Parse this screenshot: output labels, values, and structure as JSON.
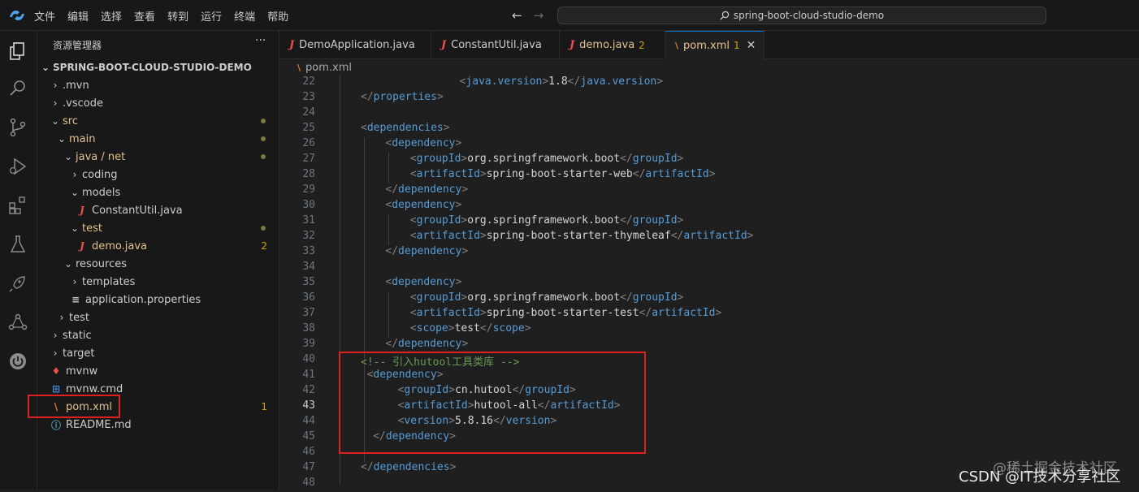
{
  "menu": [
    "文件",
    "编辑",
    "选择",
    "查看",
    "转到",
    "运行",
    "终端",
    "帮助"
  ],
  "search": {
    "text": "spring-boot-cloud-studio-demo"
  },
  "sidebar": {
    "title": "资源管理器",
    "more": "···",
    "root": "SPRING-BOOT-CLOUD-STUDIO-DEMO",
    "items": [
      {
        "label": ".mvn"
      },
      {
        "label": ".vscode"
      },
      {
        "label": "src"
      },
      {
        "label": "main"
      },
      {
        "label": "java / net"
      },
      {
        "label": "coding"
      },
      {
        "label": "models"
      },
      {
        "label": "ConstantUtil.java"
      },
      {
        "label": "test"
      },
      {
        "label": "demo.java",
        "badge": "2"
      },
      {
        "label": "resources"
      },
      {
        "label": "templates"
      },
      {
        "label": "application.properties"
      },
      {
        "label": "test"
      },
      {
        "label": "static"
      },
      {
        "label": "target"
      },
      {
        "label": "mvnw"
      },
      {
        "label": "mvnw.cmd"
      },
      {
        "label": "pom.xml",
        "badge": "1"
      },
      {
        "label": "README.md"
      }
    ]
  },
  "tabs": [
    {
      "label": "DemoApplication.java"
    },
    {
      "label": "ConstantUtil.java"
    },
    {
      "label": "demo.java",
      "badge": "2"
    },
    {
      "label": "pom.xml",
      "badge": "1"
    }
  ],
  "breadcrumb": "pom.xml",
  "editor": {
    "lines": [
      {
        "n": "22",
        "tokens": [
          [
            "tg",
            "<"
          ],
          [
            "tn",
            "java.version"
          ],
          [
            "tg",
            ">"
          ],
          [
            "tx",
            "1.8"
          ],
          [
            "tg",
            "</"
          ],
          [
            "tn",
            "java.version"
          ],
          [
            "tg",
            ">"
          ]
        ]
      },
      {
        "n": "23",
        "tokens": [
          [
            "tg",
            "</"
          ],
          [
            "tn",
            "properties"
          ],
          [
            "tg",
            ">"
          ]
        ]
      },
      {
        "n": "24",
        "tokens": []
      },
      {
        "n": "25",
        "tokens": [
          [
            "tg",
            "<"
          ],
          [
            "tn",
            "dependencies"
          ],
          [
            "tg",
            ">"
          ]
        ]
      },
      {
        "n": "26",
        "tokens": [
          [
            "tg",
            "<"
          ],
          [
            "tn",
            "dependency"
          ],
          [
            "tg",
            ">"
          ]
        ]
      },
      {
        "n": "27",
        "tokens": [
          [
            "tg",
            "<"
          ],
          [
            "tn",
            "groupId"
          ],
          [
            "tg",
            ">"
          ],
          [
            "tx",
            "org.springframework.boot"
          ],
          [
            "tg",
            "</"
          ],
          [
            "tn",
            "groupId"
          ],
          [
            "tg",
            ">"
          ]
        ]
      },
      {
        "n": "28",
        "tokens": [
          [
            "tg",
            "<"
          ],
          [
            "tn",
            "artifactId"
          ],
          [
            "tg",
            ">"
          ],
          [
            "tx",
            "spring-boot-starter-web"
          ],
          [
            "tg",
            "</"
          ],
          [
            "tn",
            "artifactId"
          ],
          [
            "tg",
            ">"
          ]
        ]
      },
      {
        "n": "29",
        "tokens": [
          [
            "tg",
            "</"
          ],
          [
            "tn",
            "dependency"
          ],
          [
            "tg",
            ">"
          ]
        ]
      },
      {
        "n": "30",
        "tokens": [
          [
            "tg",
            "<"
          ],
          [
            "tn",
            "dependency"
          ],
          [
            "tg",
            ">"
          ]
        ]
      },
      {
        "n": "31",
        "tokens": [
          [
            "tg",
            "<"
          ],
          [
            "tn",
            "groupId"
          ],
          [
            "tg",
            ">"
          ],
          [
            "tx",
            "org.springframework.boot"
          ],
          [
            "tg",
            "</"
          ],
          [
            "tn",
            "groupId"
          ],
          [
            "tg",
            ">"
          ]
        ]
      },
      {
        "n": "32",
        "tokens": [
          [
            "tg",
            "<"
          ],
          [
            "tn",
            "artifactId"
          ],
          [
            "tg",
            ">"
          ],
          [
            "tx",
            "spring-boot-starter-thymeleaf"
          ],
          [
            "tg",
            "</"
          ],
          [
            "tn",
            "artifactId"
          ],
          [
            "tg",
            ">"
          ]
        ]
      },
      {
        "n": "33",
        "tokens": [
          [
            "tg",
            "</"
          ],
          [
            "tn",
            "dependency"
          ],
          [
            "tg",
            ">"
          ]
        ]
      },
      {
        "n": "34",
        "tokens": []
      },
      {
        "n": "35",
        "tokens": [
          [
            "tg",
            "<"
          ],
          [
            "tn",
            "dependency"
          ],
          [
            "tg",
            ">"
          ]
        ]
      },
      {
        "n": "36",
        "tokens": [
          [
            "tg",
            "<"
          ],
          [
            "tn",
            "groupId"
          ],
          [
            "tg",
            ">"
          ],
          [
            "tx",
            "org.springframework.boot"
          ],
          [
            "tg",
            "</"
          ],
          [
            "tn",
            "groupId"
          ],
          [
            "tg",
            ">"
          ]
        ]
      },
      {
        "n": "37",
        "tokens": [
          [
            "tg",
            "<"
          ],
          [
            "tn",
            "artifactId"
          ],
          [
            "tg",
            ">"
          ],
          [
            "tx",
            "spring-boot-starter-test"
          ],
          [
            "tg",
            "</"
          ],
          [
            "tn",
            "artifactId"
          ],
          [
            "tg",
            ">"
          ]
        ]
      },
      {
        "n": "38",
        "tokens": [
          [
            "tg",
            "<"
          ],
          [
            "tn",
            "scope"
          ],
          [
            "tg",
            ">"
          ],
          [
            "tx",
            "test"
          ],
          [
            "tg",
            "</"
          ],
          [
            "tn",
            "scope"
          ],
          [
            "tg",
            ">"
          ]
        ]
      },
      {
        "n": "39",
        "tokens": [
          [
            "tg",
            "</"
          ],
          [
            "tn",
            "dependency"
          ],
          [
            "tg",
            ">"
          ]
        ]
      },
      {
        "n": "40",
        "tokens": [
          [
            "cm",
            "<!-- 引入hutool工具类库 -->"
          ]
        ]
      },
      {
        "n": "41",
        "tokens": [
          [
            "tg",
            "<"
          ],
          [
            "tn",
            "dependency"
          ],
          [
            "tg",
            ">"
          ]
        ]
      },
      {
        "n": "42",
        "tokens": [
          [
            "tg",
            "<"
          ],
          [
            "tn",
            "groupId"
          ],
          [
            "tg",
            ">"
          ],
          [
            "tx",
            "cn.hutool"
          ],
          [
            "tg",
            "</"
          ],
          [
            "tn",
            "groupId"
          ],
          [
            "tg",
            ">"
          ]
        ]
      },
      {
        "n": "43",
        "tokens": [
          [
            "tg",
            "<"
          ],
          [
            "tn",
            "artifactId"
          ],
          [
            "tg",
            ">"
          ],
          [
            "tx",
            "hutool-all"
          ],
          [
            "tg",
            "</"
          ],
          [
            "tn",
            "artifactId"
          ],
          [
            "tg",
            ">"
          ]
        ]
      },
      {
        "n": "44",
        "tokens": [
          [
            "tg",
            "<"
          ],
          [
            "tn",
            "version"
          ],
          [
            "tg",
            ">"
          ],
          [
            "tx",
            "5.8.16"
          ],
          [
            "tg",
            "</"
          ],
          [
            "tn",
            "version"
          ],
          [
            "tg",
            ">"
          ]
        ]
      },
      {
        "n": "45",
        "tokens": [
          [
            "tg",
            "</"
          ],
          [
            "tn",
            "dependency"
          ],
          [
            "tg",
            ">"
          ]
        ]
      },
      {
        "n": "46",
        "tokens": []
      },
      {
        "n": "47",
        "tokens": [
          [
            "tg",
            "</"
          ],
          [
            "tn",
            "dependencies"
          ],
          [
            "tg",
            ">"
          ]
        ]
      },
      {
        "n": "48",
        "tokens": []
      }
    ]
  },
  "watermark": {
    "csdn": "CSDN @IT技术分享社区",
    "juejin": "@稀土掘金技术社区"
  },
  "colors": {
    "accent": "#0078d4",
    "highlight_box": "#e02020",
    "git_modified": "#e2c08d",
    "warning_badge": "#cca700"
  }
}
